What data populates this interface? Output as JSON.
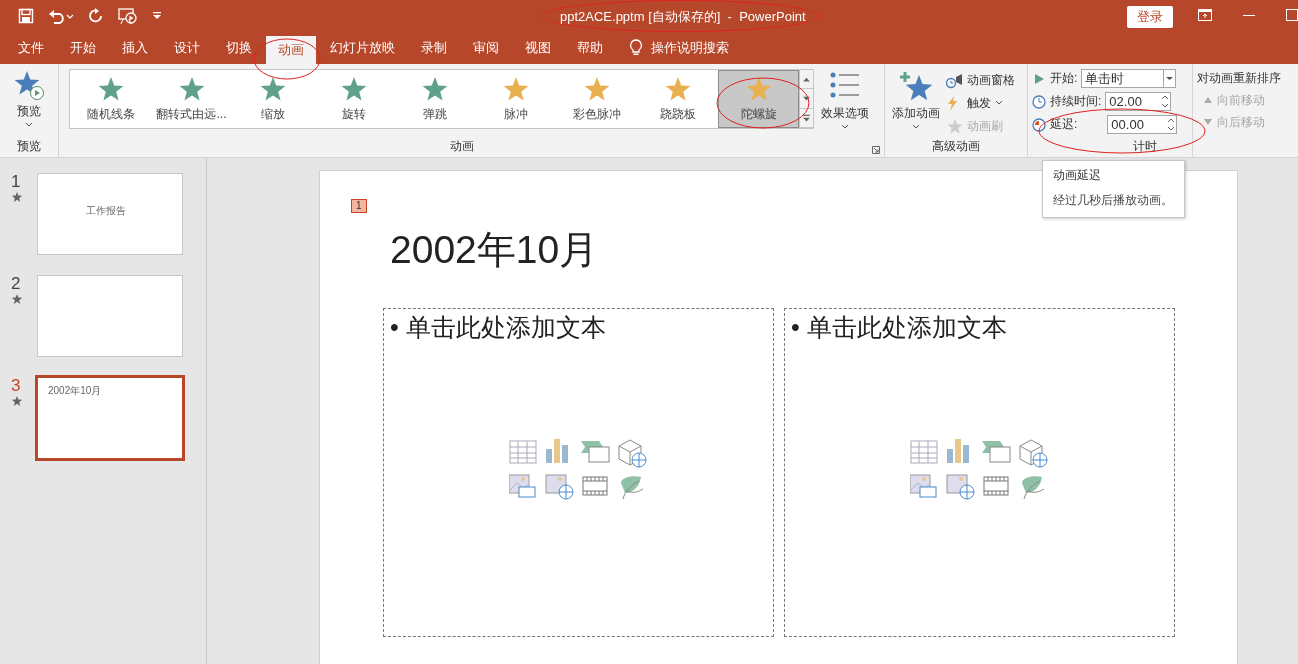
{
  "title_bar": {
    "title": "ppt2ACE.pptm [自动保存的]  -  PowerPoint",
    "login": "登录"
  },
  "tabs": [
    {
      "label": "文件",
      "selected": false
    },
    {
      "label": "开始",
      "selected": false
    },
    {
      "label": "插入",
      "selected": false
    },
    {
      "label": "设计",
      "selected": false
    },
    {
      "label": "切换",
      "selected": false
    },
    {
      "label": "动画",
      "selected": true
    },
    {
      "label": "幻灯片放映",
      "selected": false
    },
    {
      "label": "录制",
      "selected": false
    },
    {
      "label": "审阅",
      "selected": false
    },
    {
      "label": "视图",
      "selected": false
    },
    {
      "label": "帮助",
      "selected": false
    }
  ],
  "tell_me": {
    "placeholder": "操作说明搜索"
  },
  "ribbon": {
    "preview": {
      "button": "预览",
      "group_label": "预览"
    },
    "animations": {
      "items": [
        {
          "label": "随机线条",
          "kind": "entrance",
          "selected": false
        },
        {
          "label": "翻转式由远...",
          "kind": "entrance",
          "selected": false
        },
        {
          "label": "缩放",
          "kind": "entrance",
          "selected": false
        },
        {
          "label": "旋转",
          "kind": "entrance",
          "selected": false
        },
        {
          "label": "弹跳",
          "kind": "entrance",
          "selected": false
        },
        {
          "label": "脉冲",
          "kind": "emphasis",
          "selected": false
        },
        {
          "label": "彩色脉冲",
          "kind": "emphasis",
          "selected": false
        },
        {
          "label": "跷跷板",
          "kind": "emphasis",
          "selected": false
        },
        {
          "label": "陀螺旋",
          "kind": "emphasis",
          "selected": true
        }
      ],
      "effect_options": "效果选项",
      "group_label": "动画"
    },
    "advanced": {
      "add_animation": "添加动画",
      "items": [
        {
          "label": "动画窗格",
          "disabled": false,
          "kind": "pane"
        },
        {
          "label": "触发",
          "disabled": false,
          "kind": "trigger"
        },
        {
          "label": "动画刷",
          "disabled": true,
          "kind": "painter"
        }
      ],
      "group_label": "高级动画"
    },
    "timing": {
      "start_label": "开始:",
      "start_value": "单击时",
      "duration_label": "持续时间:",
      "duration_value": "02.00",
      "delay_label": "延迟:",
      "delay_value": "00.00",
      "group_label": "计时"
    },
    "reorder": {
      "title": "对动画重新排序",
      "items": [
        {
          "label": "向前移动",
          "disabled": true
        },
        {
          "label": "向后移动",
          "disabled": true
        }
      ]
    }
  },
  "tooltip": {
    "title": "动画延迟",
    "text": "经过几秒后播放动画。"
  },
  "slides": [
    {
      "number": "1",
      "animated": true,
      "selected": false,
      "text": "工作报告"
    },
    {
      "number": "2",
      "animated": true,
      "selected": false
    },
    {
      "number": "3",
      "animated": true,
      "selected": true,
      "text": "2002年10月"
    }
  ],
  "slide": {
    "animation_tag": "1",
    "title": "2002年10月",
    "placeholders": [
      "• 单击此处添加文本",
      "• 单击此处添加文本"
    ]
  }
}
